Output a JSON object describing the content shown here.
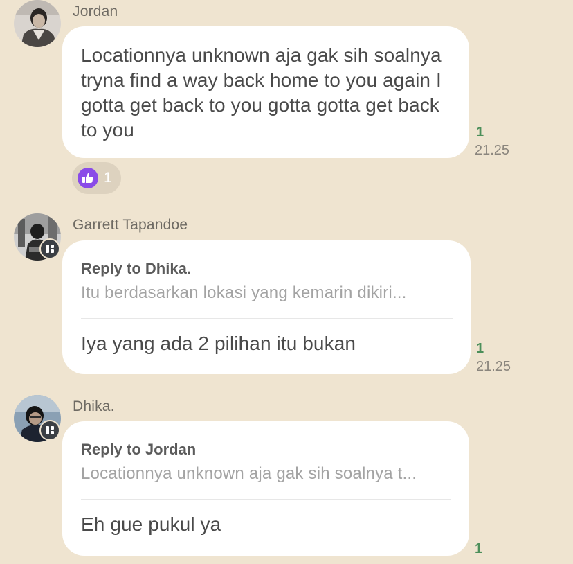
{
  "messages": [
    {
      "sender": "Jordan",
      "text": "Locationnya unknown aja gak sih soalnya tryna find a way back home to you again I gotta get back to you gotta gotta get back to you",
      "read_count": "1",
      "time": "21.25",
      "reaction": {
        "icon": "thumbs-up-icon",
        "count": "1"
      }
    },
    {
      "sender": "Garrett Tapandoe",
      "reply_label": "Reply to Dhika.",
      "reply_preview": "Itu berdasarkan lokasi yang kemarin dikiri...",
      "text": "Iya yang ada 2 pilihan itu bukan",
      "read_count": "1",
      "time": "21.25"
    },
    {
      "sender": "Dhika.",
      "reply_label": "Reply to Jordan",
      "reply_preview": "Locationnya unknown aja gak sih soalnya t...",
      "text": "Eh gue pukul ya",
      "read_count": "1"
    }
  ],
  "colors": {
    "background": "#efe4d0",
    "bubble": "#ffffff",
    "read_count": "#4c8f5a",
    "reaction": "#8a4be8"
  }
}
